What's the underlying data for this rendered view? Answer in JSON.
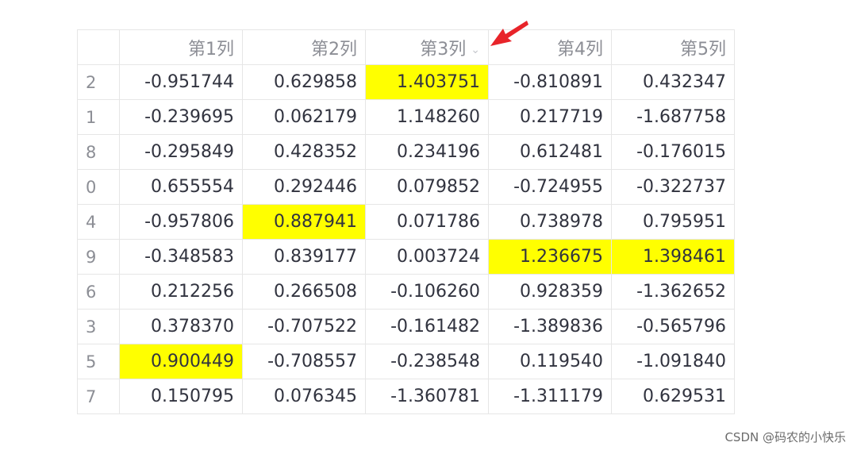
{
  "table": {
    "columns": [
      "第1列",
      "第2列",
      "第3列",
      "第4列",
      "第5列"
    ],
    "sorted_column_index": 2,
    "sort_indicator": "chevron-down-icon",
    "highlight_color": "#ffff00",
    "rows": [
      {
        "index": "2",
        "values": [
          "-0.951744",
          "0.629858",
          "1.403751",
          "-0.810891",
          "0.432347"
        ],
        "highlight": [
          2
        ]
      },
      {
        "index": "1",
        "values": [
          "-0.239695",
          "0.062179",
          "1.148260",
          "0.217719",
          "-1.687758"
        ],
        "highlight": []
      },
      {
        "index": "8",
        "values": [
          "-0.295849",
          "0.428352",
          "0.234196",
          "0.612481",
          "-0.176015"
        ],
        "highlight": []
      },
      {
        "index": "0",
        "values": [
          "0.655554",
          "0.292446",
          "0.079852",
          "-0.724955",
          "-0.322737"
        ],
        "highlight": []
      },
      {
        "index": "4",
        "values": [
          "-0.957806",
          "0.887941",
          "0.071786",
          "0.738978",
          "0.795951"
        ],
        "highlight": [
          1
        ]
      },
      {
        "index": "9",
        "values": [
          "-0.348583",
          "0.839177",
          "0.003724",
          "1.236675",
          "1.398461"
        ],
        "highlight": [
          3,
          4
        ]
      },
      {
        "index": "6",
        "values": [
          "0.212256",
          "0.266508",
          "-0.106260",
          "0.928359",
          "-1.362652"
        ],
        "highlight": []
      },
      {
        "index": "3",
        "values": [
          "0.378370",
          "-0.707522",
          "-0.161482",
          "-1.389836",
          "-0.565796"
        ],
        "highlight": []
      },
      {
        "index": "5",
        "values": [
          "0.900449",
          "-0.708557",
          "-0.238548",
          "0.119540",
          "-1.091840"
        ],
        "highlight": [
          0
        ]
      },
      {
        "index": "7",
        "values": [
          "0.150795",
          "0.076345",
          "-1.360781",
          "-1.311179",
          "0.629531"
        ],
        "highlight": []
      }
    ]
  },
  "annotation": {
    "arrow_color": "#e8242a"
  },
  "watermark": "CSDN @码农的小快乐"
}
